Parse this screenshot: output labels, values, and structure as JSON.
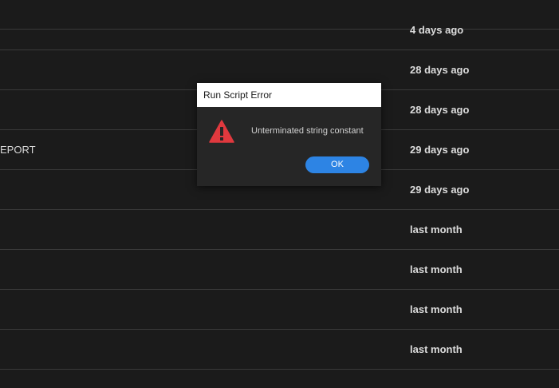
{
  "list": {
    "rows": [
      {
        "name": "",
        "date": "4 days ago"
      },
      {
        "name": "",
        "date": "28 days ago"
      },
      {
        "name": "",
        "date": "28 days ago"
      },
      {
        "name": "EPORT",
        "date": "29 days ago"
      },
      {
        "name": "",
        "date": "29 days ago"
      },
      {
        "name": "",
        "date": "last month"
      },
      {
        "name": "",
        "date": "last month"
      },
      {
        "name": "",
        "date": "last month"
      },
      {
        "name": "",
        "date": "last month"
      }
    ]
  },
  "dialog": {
    "title": "Run Script Error",
    "icon": "warning-icon",
    "message": "Unterminated string constant",
    "ok_label": "OK",
    "accent_color": "#2d84e4",
    "warning_color": "#e0393e"
  }
}
